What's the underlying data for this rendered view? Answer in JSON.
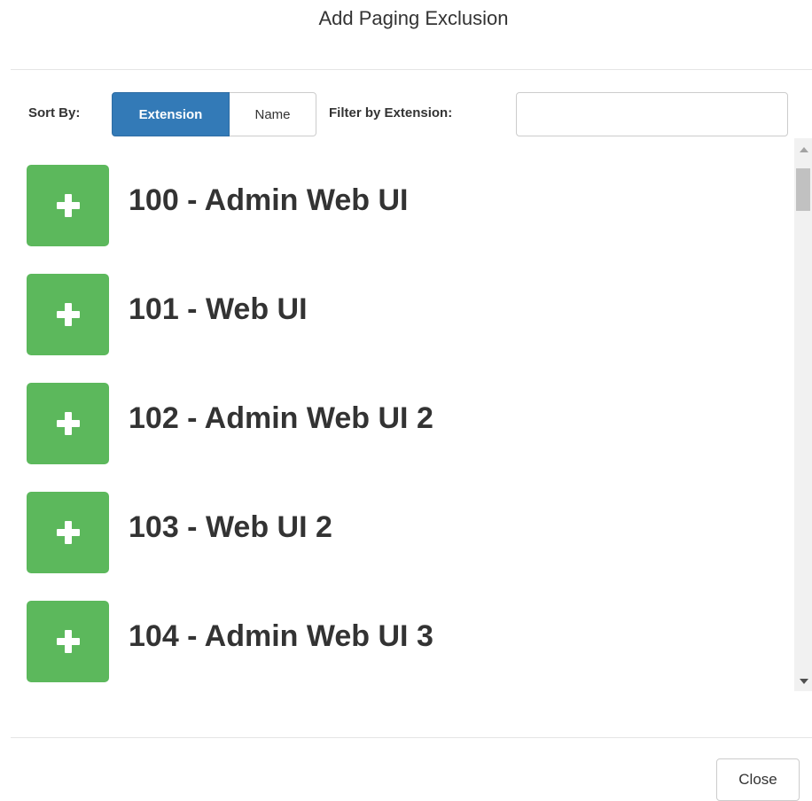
{
  "modal": {
    "title": "Add Paging Exclusion",
    "close_label": "Close"
  },
  "toolbar": {
    "sort_label": "Sort By:",
    "sort_options": [
      {
        "label": "Extension",
        "active": true
      },
      {
        "label": "Name",
        "active": false
      }
    ],
    "filter_label": "Filter by Extension:",
    "filter_value": "",
    "filter_placeholder": ""
  },
  "list": {
    "items": [
      {
        "label": "100 - Admin Web UI",
        "icon": "plus-icon"
      },
      {
        "label": "101 - Web UI",
        "icon": "plus-icon"
      },
      {
        "label": "102 - Admin Web UI 2",
        "icon": "plus-icon"
      },
      {
        "label": "103 - Web UI 2",
        "icon": "plus-icon"
      },
      {
        "label": "104 - Admin Web UI 3",
        "icon": "plus-icon"
      }
    ]
  },
  "colors": {
    "primary": "#337ab7",
    "success": "#5cb85c",
    "text": "#333333",
    "border": "#cccccc"
  }
}
